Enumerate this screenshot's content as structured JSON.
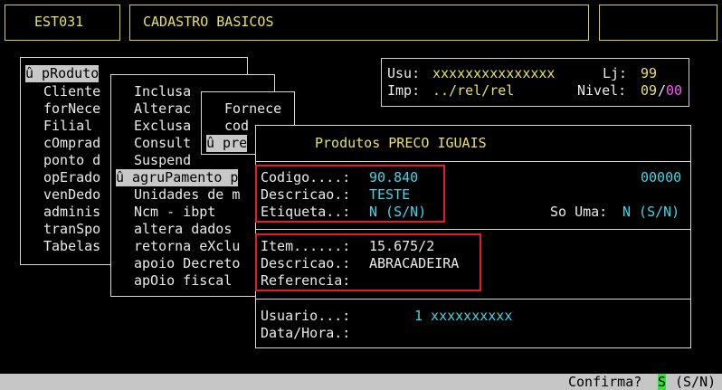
{
  "header": {
    "program_code": "EST031",
    "screen_title": "CADASTRO BASICOS"
  },
  "info": {
    "usu_label": "Usu:",
    "usu_value": "xxxxxxxxxxxxxxx",
    "lj_label": "Lj:",
    "lj_value": "99",
    "imp_label": "Imp:",
    "imp_value": "../rel/rel",
    "nivel_label": "Nivel:",
    "nivel_a": "09",
    "nivel_sep": "/",
    "nivel_b": "00"
  },
  "main_menu": {
    "selected": "û pRoduto",
    "items": [
      "Cliente",
      "forNece",
      "Filial",
      "cOmprad",
      "ponto d",
      "opErado",
      "venDedo",
      "adminis",
      "tranSpo",
      "Tabelas"
    ]
  },
  "produto_menu": {
    "items": [
      "Inclusa",
      "Alterac",
      "Exclusa",
      "Consult",
      "Suspend"
    ],
    "selected": "û agruPamento p",
    "more_items": [
      "Unidades de m",
      "Ncm - ibpt",
      "altera dados",
      "retorna eXclu",
      "apoio Decreto",
      "apOio fiscal"
    ]
  },
  "submenu": {
    "items": [
      "Fornece",
      "cod"
    ],
    "selected": "û pre"
  },
  "dialog": {
    "title": "Produtos PRECO IGUAIS",
    "codigo_label": "Codigo....:",
    "codigo_value": "90.840",
    "codigo_right": "00000",
    "descricao_label": "Descricao.:",
    "descricao_value": "TESTE",
    "etiqueta_label": "Etiqueta..:",
    "etiqueta_value": "N (S/N)",
    "so_uma_label": "So Uma:",
    "so_uma_value": "N (S/N)",
    "item_label": "Item......:",
    "item_value": "15.675/2",
    "item_desc_label": "Descricao.:",
    "item_desc_value": "ABRACADEIRA",
    "referencia_label": "Referencia:",
    "usuario_label": "Usuario...:",
    "usuario_value": "1 xxxxxxxxxx",
    "datahora_label": "Data/Hora.:"
  },
  "status": {
    "prompt": "Confirma?",
    "answer": "S",
    "options": "(S/N)"
  }
}
